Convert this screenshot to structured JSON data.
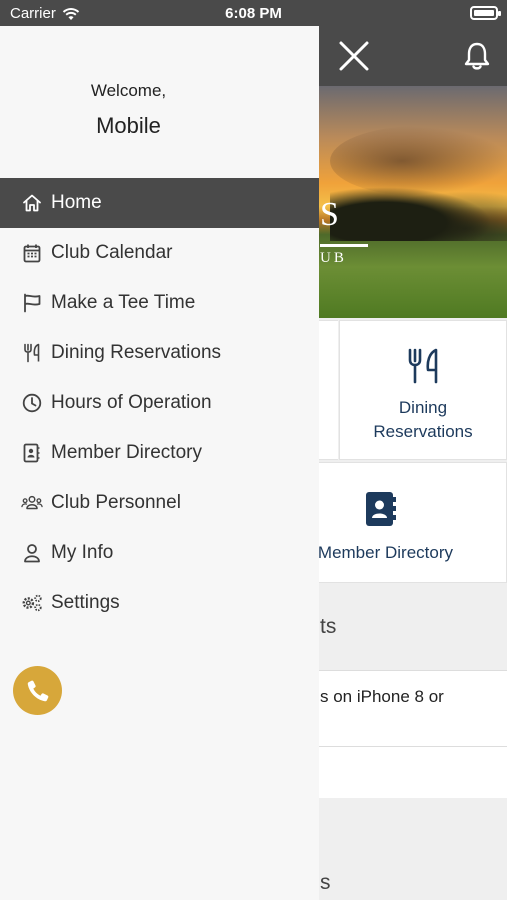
{
  "status_bar": {
    "carrier": "Carrier",
    "time": "6:08 PM"
  },
  "drawer": {
    "welcome": "Welcome,",
    "user_name": "Mobile",
    "menu": [
      {
        "label": "Home",
        "icon": "home-icon",
        "active": true
      },
      {
        "label": "Club Calendar",
        "icon": "calendar-icon"
      },
      {
        "label": "Make a Tee Time",
        "icon": "flag-icon"
      },
      {
        "label": "Dining Reservations",
        "icon": "utensils-icon"
      },
      {
        "label": "Hours of Operation",
        "icon": "clock-icon"
      },
      {
        "label": "Member Directory",
        "icon": "address-book-icon"
      },
      {
        "label": "Club Personnel",
        "icon": "users-icon"
      },
      {
        "label": "My Info",
        "icon": "user-icon"
      },
      {
        "label": "Settings",
        "icon": "gears-icon"
      }
    ],
    "phone_icon": "phone-icon"
  },
  "background": {
    "tiles": {
      "dining": {
        "label_line1": "Dining",
        "label_line2": "Reservations",
        "icon": "utensils-icon"
      },
      "directory": {
        "label": "Member Directory",
        "icon": "address-book-icon"
      }
    },
    "section_title_1": "ts",
    "news_item_1": "s on iPhone 8 or",
    "section_title_2": "s",
    "logo_fragment_large": "S",
    "logo_fragment_small": "UB"
  },
  "colors": {
    "header": "#4a4a4a",
    "accent_gold": "#d7a73a",
    "tile_text": "#1d3a5c",
    "drawer_bg": "#f7f7f7"
  }
}
